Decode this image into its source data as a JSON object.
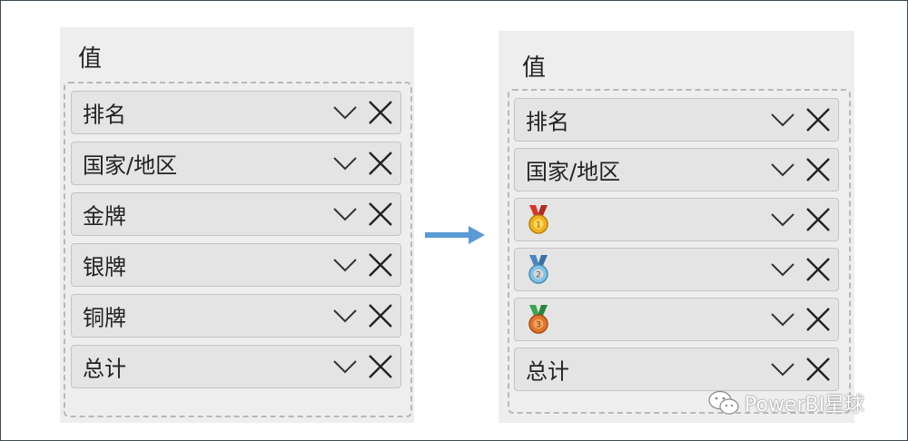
{
  "left_panel": {
    "title": "值",
    "fields": [
      {
        "label": "排名"
      },
      {
        "label": "国家/地区"
      },
      {
        "label": "金牌"
      },
      {
        "label": "银牌"
      },
      {
        "label": "铜牌"
      },
      {
        "label": "总计"
      }
    ]
  },
  "right_panel": {
    "title": "值",
    "fields": [
      {
        "label": "排名",
        "icon": ""
      },
      {
        "label": "国家/地区",
        "icon": ""
      },
      {
        "label": "",
        "icon": "gold-medal-icon"
      },
      {
        "label": "",
        "icon": "silver-medal-icon"
      },
      {
        "label": "",
        "icon": "bronze-medal-icon"
      },
      {
        "label": "总计",
        "icon": ""
      }
    ]
  },
  "arrow": {
    "color": "#5b9bd5"
  },
  "watermark": {
    "text": "PowerBI星球"
  },
  "colors": {
    "panel_bg": "#eeeeee",
    "field_bg": "#e4e4e4",
    "gold": "#f2b21c",
    "silver": "#7fc3e6",
    "bronze": "#e2742a",
    "ribbon_red": "#d9362b",
    "ribbon_blue": "#4a86c5",
    "ribbon_green": "#3aa655"
  }
}
